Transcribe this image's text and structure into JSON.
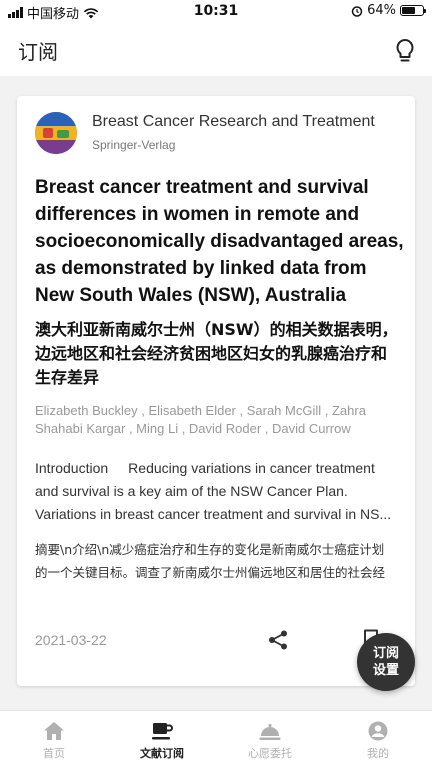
{
  "status_bar": {
    "carrier": "中国移动",
    "time": "10:31",
    "battery": "64%",
    "battery_level": 0.64
  },
  "header": {
    "title": "订阅",
    "icon": "lightbulb-icon"
  },
  "article": {
    "journal_name": "Breast Cancer Research and Treatment",
    "publisher": "Springer-Verlag",
    "title_en": "Breast cancer treatment and survival differences in women in remote and socioeconomically disadvantaged areas, as demonstrated by linked data from New South Wales (NSW), Australia",
    "title_zh": "澳大利亚新南威尔士州（NSW）的相关数据表明，边远地区和社会经济贫困地区妇女的乳腺癌治疗和生存差异",
    "authors": "Elizabeth Buckley , Elisabeth Elder , Sarah McGill , Zahra Shahabi Kargar , Ming Li , David Roder , David Currow",
    "abstract_en_label": "Introduction",
    "abstract_en": "Reducing variations in cancer treatment and survival is a key aim of the NSW Cancer Plan. Variations in breast cancer treatment and survival in NS...",
    "abstract_zh": "摘要\\n介绍\\n减少癌症治疗和生存的变化是新南威尔士癌症计划的一个关键目标。调查了新南威尔士州偏远地区和居住的社会经济状况对乳腺癌治疗和生存率的影响，以确定基...",
    "date": "2021-03-22",
    "share_icon": "share-icon",
    "bookmark_icon": "bookmark-icon"
  },
  "fab": {
    "line1": "订阅",
    "line2": "设置"
  },
  "bottom_nav": {
    "items": [
      {
        "label": "首页",
        "icon": "home-icon",
        "active": false
      },
      {
        "label": "文献订阅",
        "icon": "coffee-cup-icon",
        "active": true
      },
      {
        "label": "心愿委托",
        "icon": "service-bell-icon",
        "active": false
      },
      {
        "label": "我的",
        "icon": "profile-icon",
        "active": false
      }
    ]
  },
  "colors": {
    "accent_dark": "#333333",
    "inactive": "#b0b0b0",
    "muted_text": "#999999"
  }
}
